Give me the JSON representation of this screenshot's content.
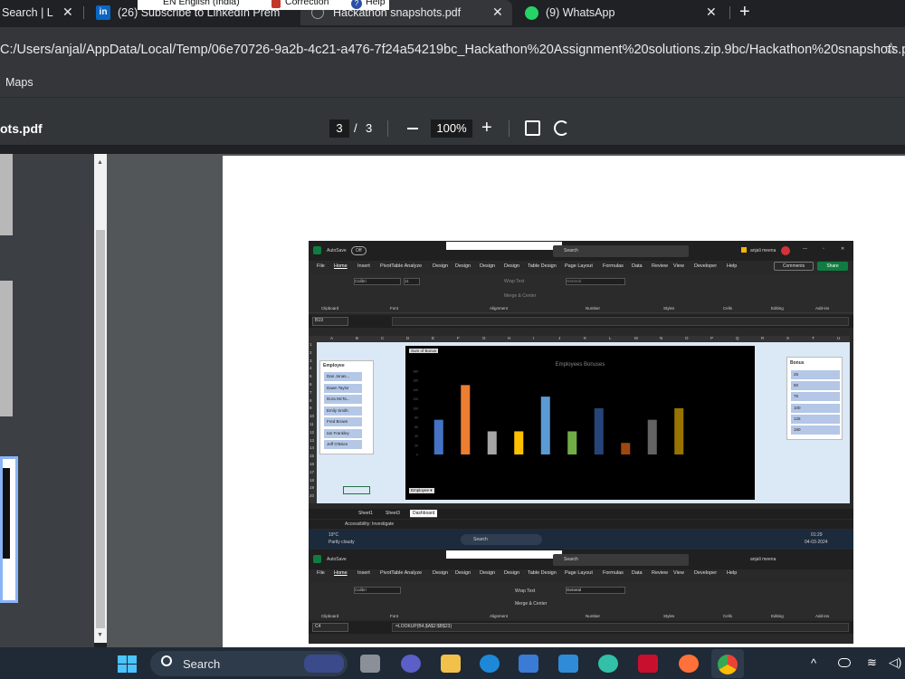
{
  "tabs": [
    {
      "label": "Search | L",
      "close": "✕"
    },
    {
      "label": "(26) Subscribe to LinkedIn Prem",
      "close": "✕"
    },
    {
      "label": "Hackathon snapshots.pdf",
      "close": "✕"
    },
    {
      "label": "(9) WhatsApp",
      "close": "✕"
    }
  ],
  "new_tab": "+",
  "language_popup": {
    "lang": "EN English (India)",
    "correction": "Correction",
    "help": "Help"
  },
  "url": "C:/Users/anjal/AppData/Local/Temp/06e70726-9a2b-4c21-a476-7f24a54219bc_Hackathon%20Assignment%20solutions.zip.9bc/Hackathon%20snapshots.pdf",
  "bookmark": "Maps",
  "pdf": {
    "filename": "ots.pdf",
    "page_current": "3",
    "page_sep": "/",
    "page_total": "3",
    "zoom": "100%"
  },
  "excel": {
    "autosave": "AutoSave",
    "autosave_state": "Off",
    "search": "Search",
    "user": "anjali meena",
    "menu": [
      "File",
      "Home",
      "Insert",
      "PivotTable Analyze",
      "Design",
      "Design",
      "Design",
      "Design",
      "Table Design",
      "Page Layout",
      "Formulas",
      "Data",
      "Review",
      "View",
      "Developer",
      "Help"
    ],
    "comments": "Comments",
    "share": "Share",
    "groups": [
      "Clipboard",
      "Font",
      "Alignment",
      "Number",
      "Styles",
      "Cells",
      "Editing",
      "Add-ins"
    ],
    "cell_ref": "B19",
    "cell_ref2": "C4",
    "formula2": "=LOOKUP(B4,$A$2:$B$23)",
    "columns": [
      "A",
      "B",
      "C",
      "D",
      "E",
      "F",
      "G",
      "H",
      "I",
      "J",
      "K",
      "L",
      "M",
      "N",
      "O",
      "P",
      "Q",
      "R",
      "S",
      "T",
      "U"
    ],
    "rows": [
      "1",
      "2",
      "3",
      "4",
      "5",
      "6",
      "7",
      "8",
      "9",
      "10",
      "11",
      "12",
      "13",
      "14",
      "15",
      "16",
      "17",
      "18",
      "19",
      "20"
    ],
    "employee_slicer": {
      "title": "Employee",
      "items": [
        "Dan Jonas...",
        "Dawn Taylor",
        "Dora McTa...",
        "Emily Smith",
        "Fred Brown",
        "Ian Frankley",
        "Jeff O'Brien"
      ]
    },
    "bonus_slicer": {
      "title": "Bonus",
      "items": [
        "25",
        "50",
        "75",
        "100",
        "125",
        "150"
      ]
    },
    "sum_tag": "Sum of Bonus",
    "employee_filter": "Employee ▾",
    "sheets": [
      "Sheet1",
      "Sheet3",
      "Dashboard"
    ],
    "status": "Accessibility: Investigate",
    "weather_temp": "19°C",
    "weather_desc": "Partly cloudy",
    "clock": "01:29",
    "date": "04-03-2024",
    "font_name": "Calibri",
    "font_size": "11",
    "number_format": "General",
    "wrap": "Wrap Text",
    "merge": "Merge & Center"
  },
  "chart_data": {
    "type": "bar",
    "title": "Employees Bonuses",
    "categories": [
      "",
      "",
      "",
      "",
      "",
      "",
      "",
      "",
      "",
      "",
      "",
      ""
    ],
    "values": [
      75,
      150,
      50,
      50,
      125,
      50,
      100,
      25,
      75,
      100,
      0,
      0
    ],
    "colors": [
      "#4472c4",
      "#ed7d31",
      "#a5a5a5",
      "#ffc000",
      "#5b9bd5",
      "#70ad47",
      "#264478",
      "#9e480e",
      "#636363",
      "#997300"
    ],
    "ylim": [
      0,
      180
    ],
    "yticks": [
      "0",
      "20",
      "40",
      "60",
      "80",
      "100",
      "120",
      "140",
      "160",
      "180"
    ]
  },
  "taskbar": {
    "search": "Search"
  },
  "colors": {
    "chrome_bg": "#202124",
    "toolbar": "#35363a",
    "pdf_bar": "#323639",
    "viewer": "#525659",
    "excel_green": "#107c41"
  }
}
